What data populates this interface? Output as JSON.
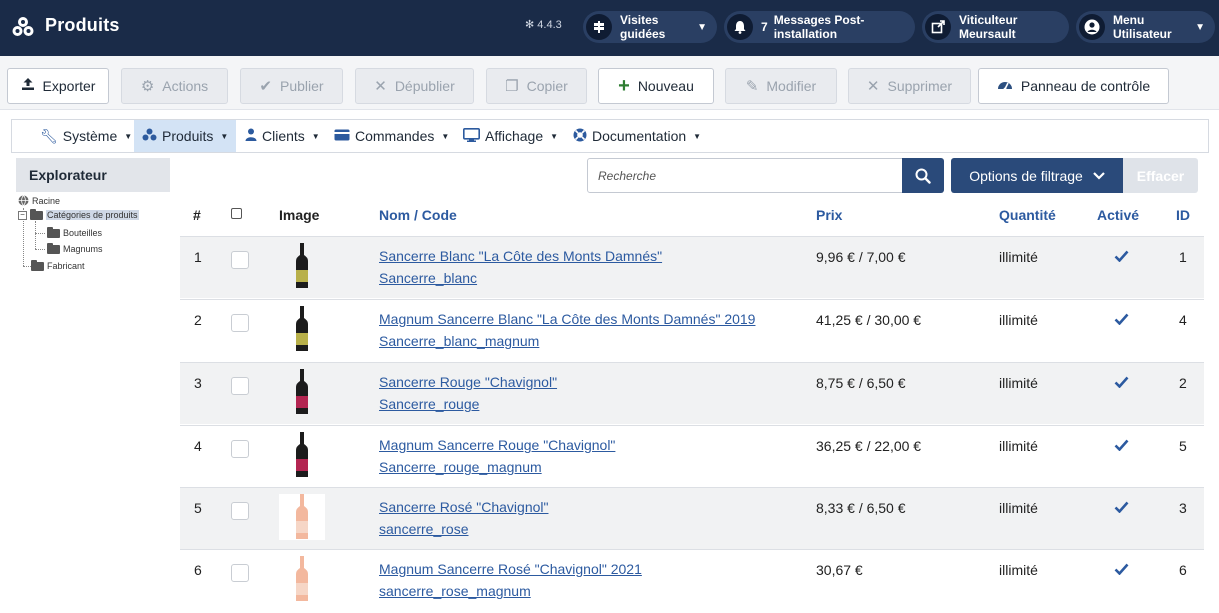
{
  "header": {
    "title": "Produits",
    "version": "4.4.3",
    "tours_label": "Visites guidées",
    "messages_count": "7",
    "messages_label": "Messages Post-installation",
    "site_label": "Viticulteur Meursault",
    "user_menu_label": "Menu Utilisateur"
  },
  "toolbar": {
    "export": "Exporter",
    "actions": "Actions",
    "publish": "Publier",
    "unpublish": "Dépublier",
    "copy": "Copier",
    "new": "Nouveau",
    "edit": "Modifier",
    "delete": "Supprimer",
    "dashboard": "Panneau de contrôle"
  },
  "menu": {
    "system": "Système",
    "products": "Produits",
    "customers": "Clients",
    "orders": "Commandes",
    "display": "Affichage",
    "documentation": "Documentation"
  },
  "explorer": {
    "title": "Explorateur",
    "root": "Racine",
    "categories": "Catégories de produits",
    "bottles": "Bouteilles",
    "magnums": "Magnums",
    "manufacturer": "Fabricant"
  },
  "filters": {
    "search_placeholder": "Recherche",
    "filter_options": "Options de filtrage",
    "clear": "Effacer"
  },
  "table": {
    "headers": {
      "num": "#",
      "image": "Image",
      "name_code": "Nom / Code",
      "price": "Prix",
      "quantity": "Quantité",
      "active": "Activé",
      "id": "ID"
    },
    "rows": [
      {
        "num": "1",
        "name": "Sancerre Blanc \"La Côte des Monts Damnés\"",
        "code": "Sancerre_blanc",
        "price": "9,96 € / 7,00 €",
        "quantity": "illimité",
        "id": "1",
        "wine": "white"
      },
      {
        "num": "2",
        "name": "Magnum Sancerre Blanc \"La Côte des Monts Damnés\" 2019",
        "code": "Sancerre_blanc_magnum",
        "price": "41,25 € / 30,00 €",
        "quantity": "illimité",
        "id": "4",
        "wine": "white"
      },
      {
        "num": "3",
        "name": "Sancerre Rouge \"Chavignol\"",
        "code": "Sancerre_rouge",
        "price": "8,75 € / 6,50 €",
        "quantity": "illimité",
        "id": "2",
        "wine": "red"
      },
      {
        "num": "4",
        "name": "Magnum Sancerre Rouge \"Chavignol\"",
        "code": "Sancerre_rouge_magnum",
        "price": "36,25 € / 22,00 €",
        "quantity": "illimité",
        "id": "5",
        "wine": "red"
      },
      {
        "num": "5",
        "name": "Sancerre Rosé \"Chavignol\"",
        "code": "sancerre_rose",
        "price": "8,33 € / 6,50 €",
        "quantity": "illimité",
        "id": "3",
        "wine": "rose"
      },
      {
        "num": "6",
        "name": "Magnum Sancerre Rosé \"Chavignol\" 2021",
        "code": "sancerre_rose_magnum",
        "price": "30,67 €",
        "quantity": "illimité",
        "id": "6",
        "wine": "rose"
      }
    ]
  },
  "colors": {
    "header_bg": "#1a2b48",
    "accent": "#2c5aa0",
    "button_primary": "#2a4a7a"
  }
}
